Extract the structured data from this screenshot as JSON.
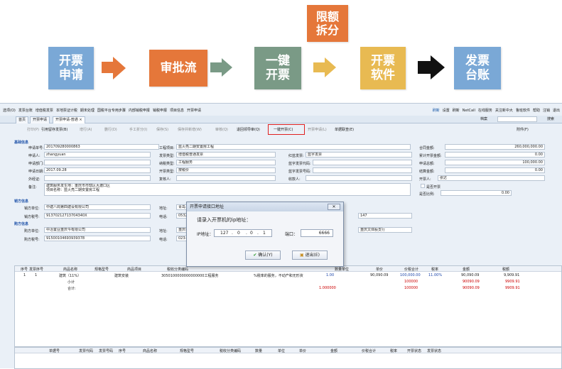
{
  "flow": {
    "step1": "开票\n申请",
    "step2": "审批流",
    "step3": "一键\n开票",
    "step3_top": "限额\n拆分",
    "step4": "开票\n软件",
    "step5": "发票\n台账",
    "colors": {
      "blue": "#7aa8d6",
      "orange": "#e5773a",
      "green": "#7a9a86",
      "yellow": "#e8ba52",
      "arrow_orange": "#e5773a",
      "arrow_yellow": "#e8ba52",
      "arrow_black": "#111111"
    }
  },
  "menubar": {
    "items": [
      "选项(O)",
      "发票台账",
      "增值税发票",
      "本地票证计税",
      "期末处理",
      "国税平台专用步骤",
      "内部销税申报",
      "销税申报",
      "项目信息",
      "开票申请"
    ],
    "right": [
      "刷新",
      "设置",
      "刷新",
      "NetCall",
      "在线服务",
      "关注新中大",
      "鲁班软件",
      "帮助",
      "注销",
      "退出"
    ]
  },
  "tabs": [
    "首页",
    "开票申请",
    "开票申请-普通 ×"
  ],
  "search_label": "档案",
  "search_button": "搜索",
  "toolbar": {
    "items": [
      "打印(P)",
      "引用留存发票(B)",
      "增行(A)",
      "删行(D)",
      "手工折分(I)",
      "保存(S)",
      "保存并新增(W)",
      "审核(Q)",
      "退回领导审(Q)",
      "一键开票(C)",
      "开票申请(L)",
      "单据联查(E)"
    ],
    "right": "附件(F)"
  },
  "form": {
    "section_basic": "基础信息",
    "apply_no_label": "申请单号:",
    "apply_no": "201709280000863",
    "project_label": "工程项目:",
    "project": "蓝火亮二期安置房工程",
    "applicant_label": "申请人:",
    "applicant": "zhangyuan",
    "invoice_type_label": "发票类型:",
    "invoice_type": "增值税普通发票",
    "red_label": "红蓝发票:",
    "red": "蓝字发票",
    "dept_label": "申请部门:",
    "tax_type_label": "纳税类型:",
    "tax_type": "工程服务",
    "blue_code_label": "蓝字发票代码:",
    "apply_date_label": "申请日期:",
    "apply_date": "2017.09.28",
    "open_type_label": "开票类型:",
    "open_type": "按税价",
    "blue_no_label": "蓝字发票号码:",
    "ext_label": "外经证:",
    "reviewer_label": "复核人:",
    "payee_label": "收款人:",
    "note_label": "备注:",
    "note": "建筑服务发生地：重庆市市辖区大渡口区\n项目名称：蓝火亮二期安置房工程",
    "contract_amount_label": "合同金额:",
    "contract_amount": "260,000,000.00",
    "total_open_label": "累计开票金额:",
    "total_open": "0.00",
    "apply_total_label": "申请总额:",
    "apply_total": "100,000.00",
    "settle_label": "结算金额:",
    "settle": "0.00",
    "drawer_label": "开票人:",
    "drawer": "张达",
    "reverse_label": "是否开票",
    "ratio_label": "是否比例:",
    "ratio": "0.00",
    "section_seller": "销方信息",
    "seller_label": "销方单位:",
    "seller": "中建八局第四建设有限公司",
    "seller_addr_label": "地址:",
    "seller_addr": "青岛",
    "seller_tax_label": "销方税号:",
    "seller_tax": "91370212713704340X",
    "seller_tel_label": "电话:",
    "seller_tel": "0532-",
    "seller_bank": "147",
    "section_buyer": "购方信息",
    "buyer_label": "购方单位:",
    "buyer": "中冶置业重庆今有限公司",
    "buyer_addr_label": "地址:",
    "buyer_addr": "重庆市",
    "buyer_tax_label": "购方税号:",
    "buyer_tax": "91500104693939378",
    "buyer_tel_label": "电话:",
    "buyer_tel": "023-6",
    "buyer_bank": "重庆文体股支行"
  },
  "grid": {
    "headers": [
      "序号",
      "发票序号",
      "商品名称",
      "规格型号",
      "商品项目",
      "税收分类编码",
      "",
      "数量",
      "单位",
      "单价",
      "价税合计",
      "税率",
      "金额",
      "税额"
    ],
    "rows": [
      {
        "no": "1",
        "inv": "1",
        "name": "建筑（11%）",
        "spec": "",
        "item": "建筑安装",
        "code": "3050100000000000000工程服务",
        "tax_name": "%税率的服务，不动产和无形资",
        "qty": "1.00",
        "price": "90,090.09",
        "total": "100,000.00",
        "rate": "11.00%",
        "amount": "90,090.09",
        "tax": "9,909.91"
      },
      {
        "label": "小计",
        "total": "100000",
        "amount": "90090.09",
        "tax": "9909.91"
      },
      {
        "label": "合计:",
        "qty": "1.000000",
        "total": "100000",
        "amount": "90090.09",
        "tax": "9909.91"
      }
    ],
    "footer_headers": [
      "单据号",
      "发票代码",
      "发票号码",
      "序号",
      "商品名称",
      "规格型号",
      "税收分类编码",
      "数量",
      "单位",
      "单价",
      "金额",
      "价税合计",
      "税率",
      "开票状态",
      "发票状态"
    ]
  },
  "dialog": {
    "title": "开票申请接口地址",
    "close": "✕",
    "prompt": "请录入开票机的ip地址：",
    "ip_label": "IP地址：",
    "ip": [
      "127",
      "0",
      "0",
      "1"
    ],
    "port_label": "端口：",
    "port": "6666",
    "ok": "确认(Y)",
    "cancel": "退出(E)"
  }
}
